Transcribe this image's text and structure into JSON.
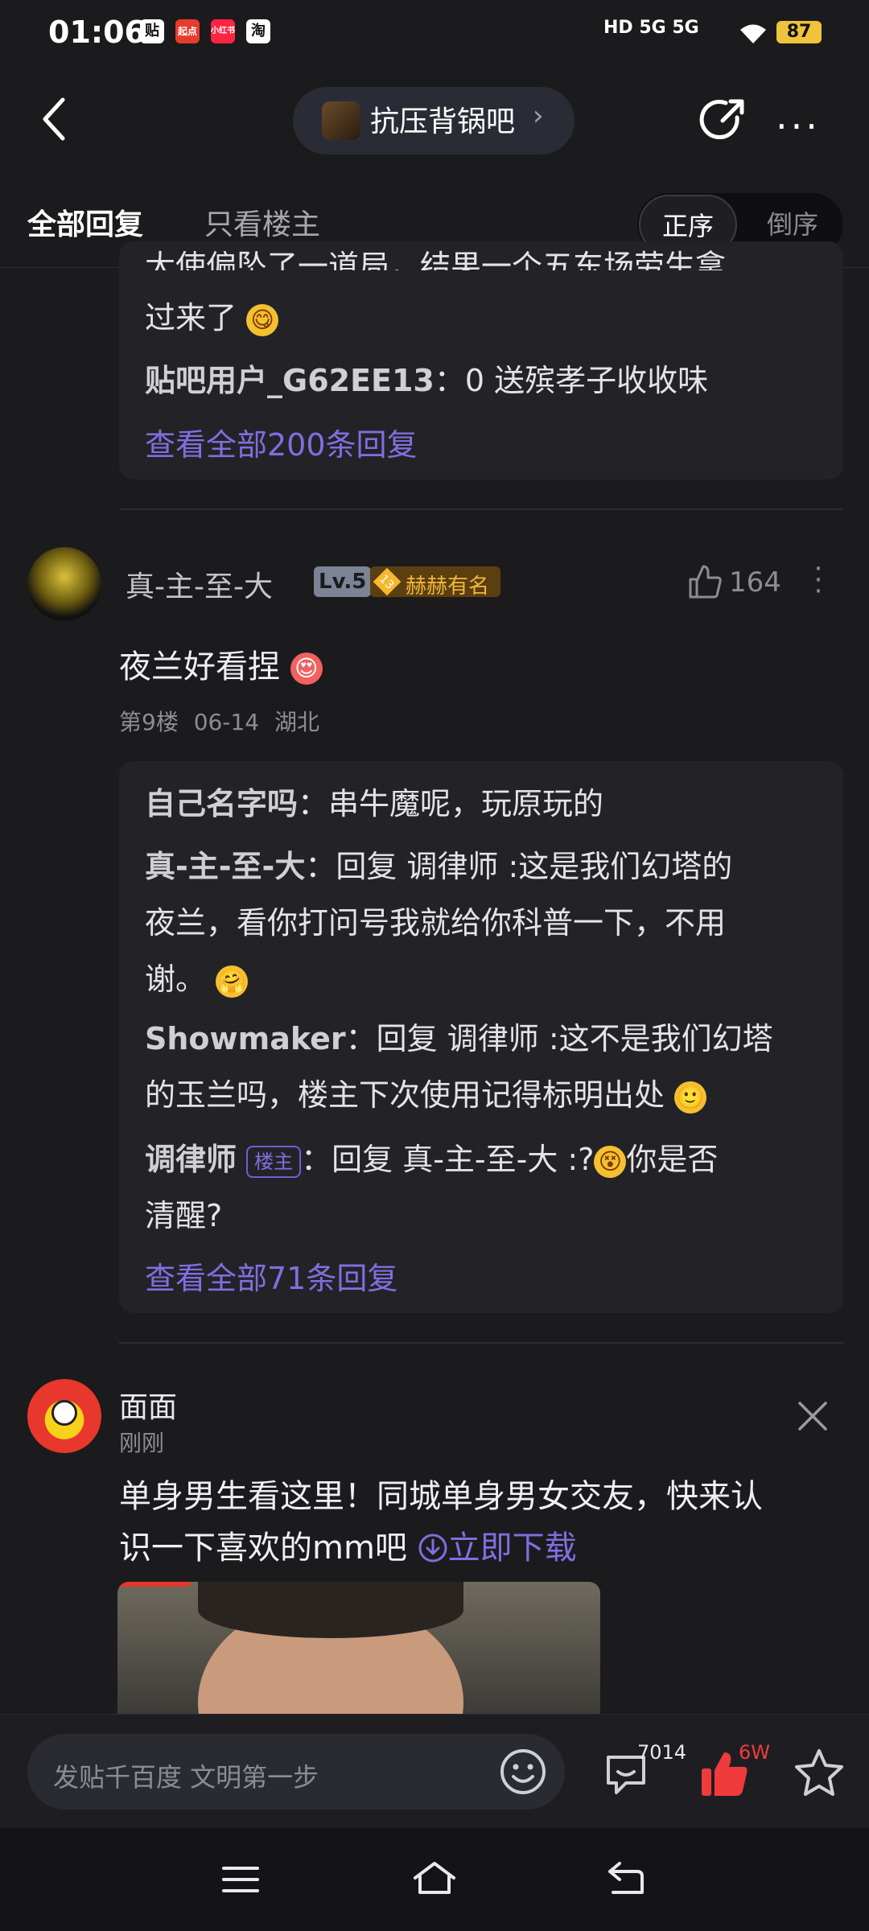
{
  "status_bar": {
    "time": "01:06",
    "app_icons": [
      "贴",
      "起点",
      "小红书",
      "淘"
    ],
    "signal": "HD 5G 5G",
    "battery": "87"
  },
  "header": {
    "forum_name": "抗压背锅吧",
    "chevron": "›"
  },
  "tabs": {
    "all_replies": "全部回复",
    "op_only": "只看楼主",
    "sort_asc": "正序",
    "sort_desc": "倒序"
  },
  "floor8_replies": {
    "partial_line_top": "大使偏坠了一道局，结果一个五东场劳生拿",
    "partial_line_2": "过来了",
    "reply_user": "贴吧用户_G62EE13",
    "reply_text": "0 送殡孝子收收味",
    "view_all": "查看全部200条回复"
  },
  "floor9": {
    "username": "真-主-至-大",
    "level": "Lv.5",
    "badge_num": "13",
    "badge_title": "赫赫有名",
    "like_count": "164",
    "content": "夜兰好看捏",
    "floor": "第9楼",
    "date": "06-14",
    "location": "湖北",
    "replies": [
      {
        "user": "自己名字吗",
        "text": "串牛魔呢，玩原玩的"
      },
      {
        "user": "真-主-至-大",
        "line1": "回复 调律师 :这是我们幻塔的",
        "line2": "夜兰，看你打问号我就给你科普一下，不用",
        "line3": "谢。"
      },
      {
        "user": "Showmaker",
        "line1": "回复 调律师 :这不是我们幻塔",
        "line2": "的玉兰吗，楼主下次使用记得标明出处"
      },
      {
        "user": "调律师",
        "op_tag": "楼主",
        "line1": "回复 真-主-至-大 :?",
        "line1b": "你是否",
        "line2": "清醒?"
      }
    ],
    "view_all": "查看全部71条回复"
  },
  "ad": {
    "name": "面面",
    "time": "刚刚",
    "line1": "单身男生看这里！同城单身男女交友，快来认",
    "line2": "识一下喜欢的mm吧",
    "download": "立即下载"
  },
  "bottom": {
    "input_placeholder": "发贴千百度 文明第一步",
    "comment_count": "7014",
    "like_count": "6W"
  }
}
